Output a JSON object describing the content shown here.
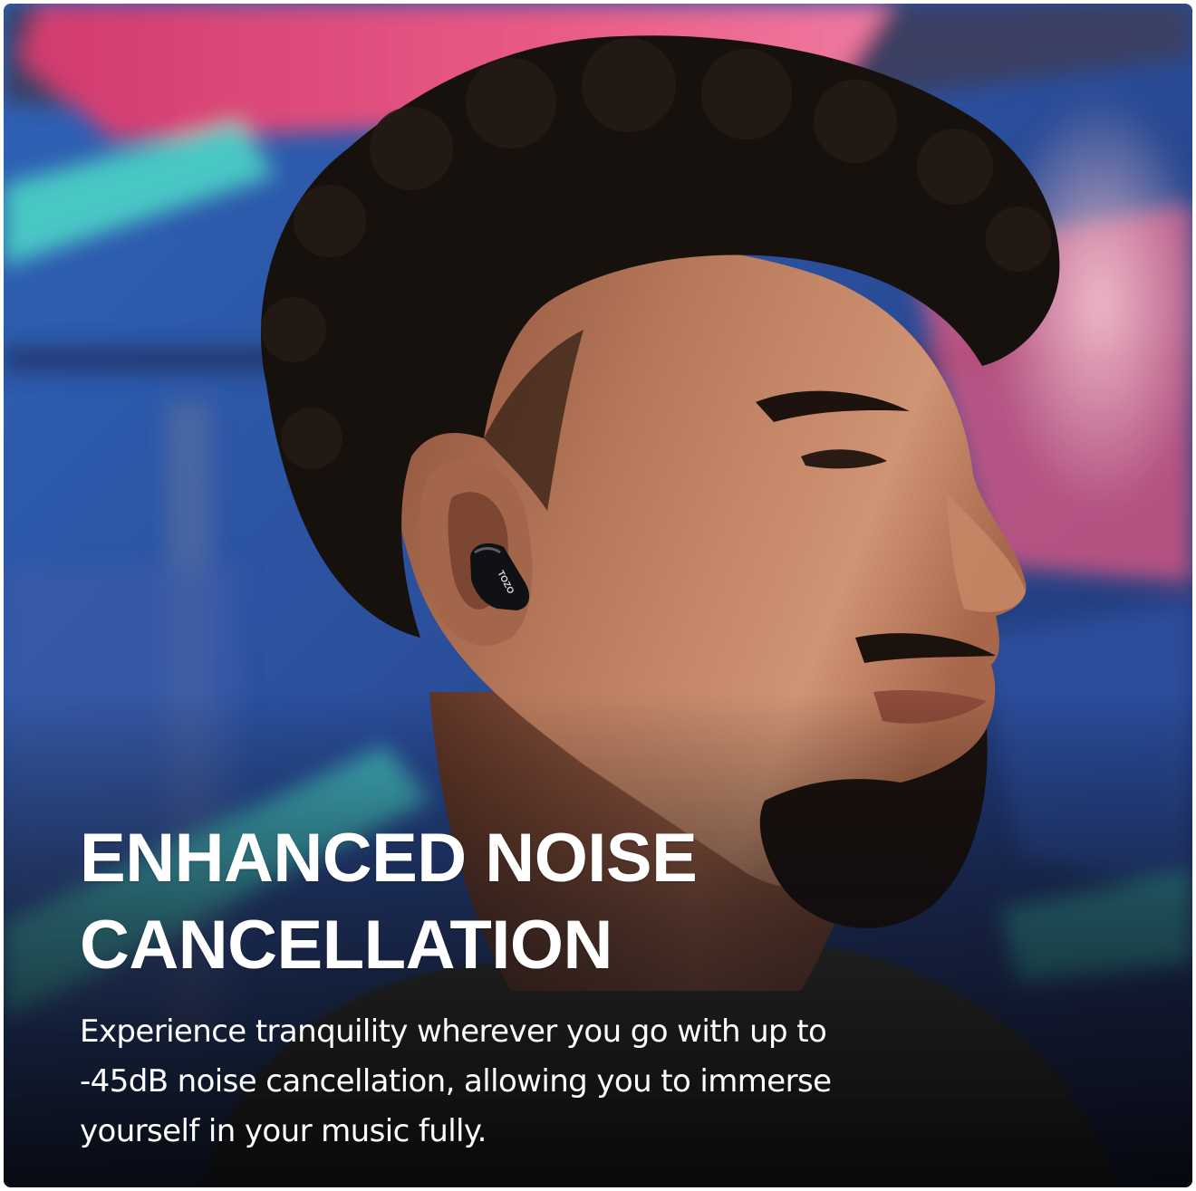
{
  "headline": {
    "line1": "ENHANCED NOISE",
    "line2": "CANCELLATION"
  },
  "description": {
    "line1": "Experience tranquility wherever you go with up to",
    "line2": "-45dB noise cancellation, allowing you to immerse",
    "line3": "yourself in your music fully."
  },
  "earbud_logo": "TOZO",
  "icons": {
    "earbud": "earbud-icon"
  },
  "colors": {
    "headline_text": "#ffffff",
    "body_text": "#ffffff",
    "background_blue": "#2f4f9a",
    "background_pink": "#e2507e",
    "background_teal": "#48c7c4",
    "earbud": "#101114",
    "skin": "#b87456",
    "hair": "#17110e"
  }
}
